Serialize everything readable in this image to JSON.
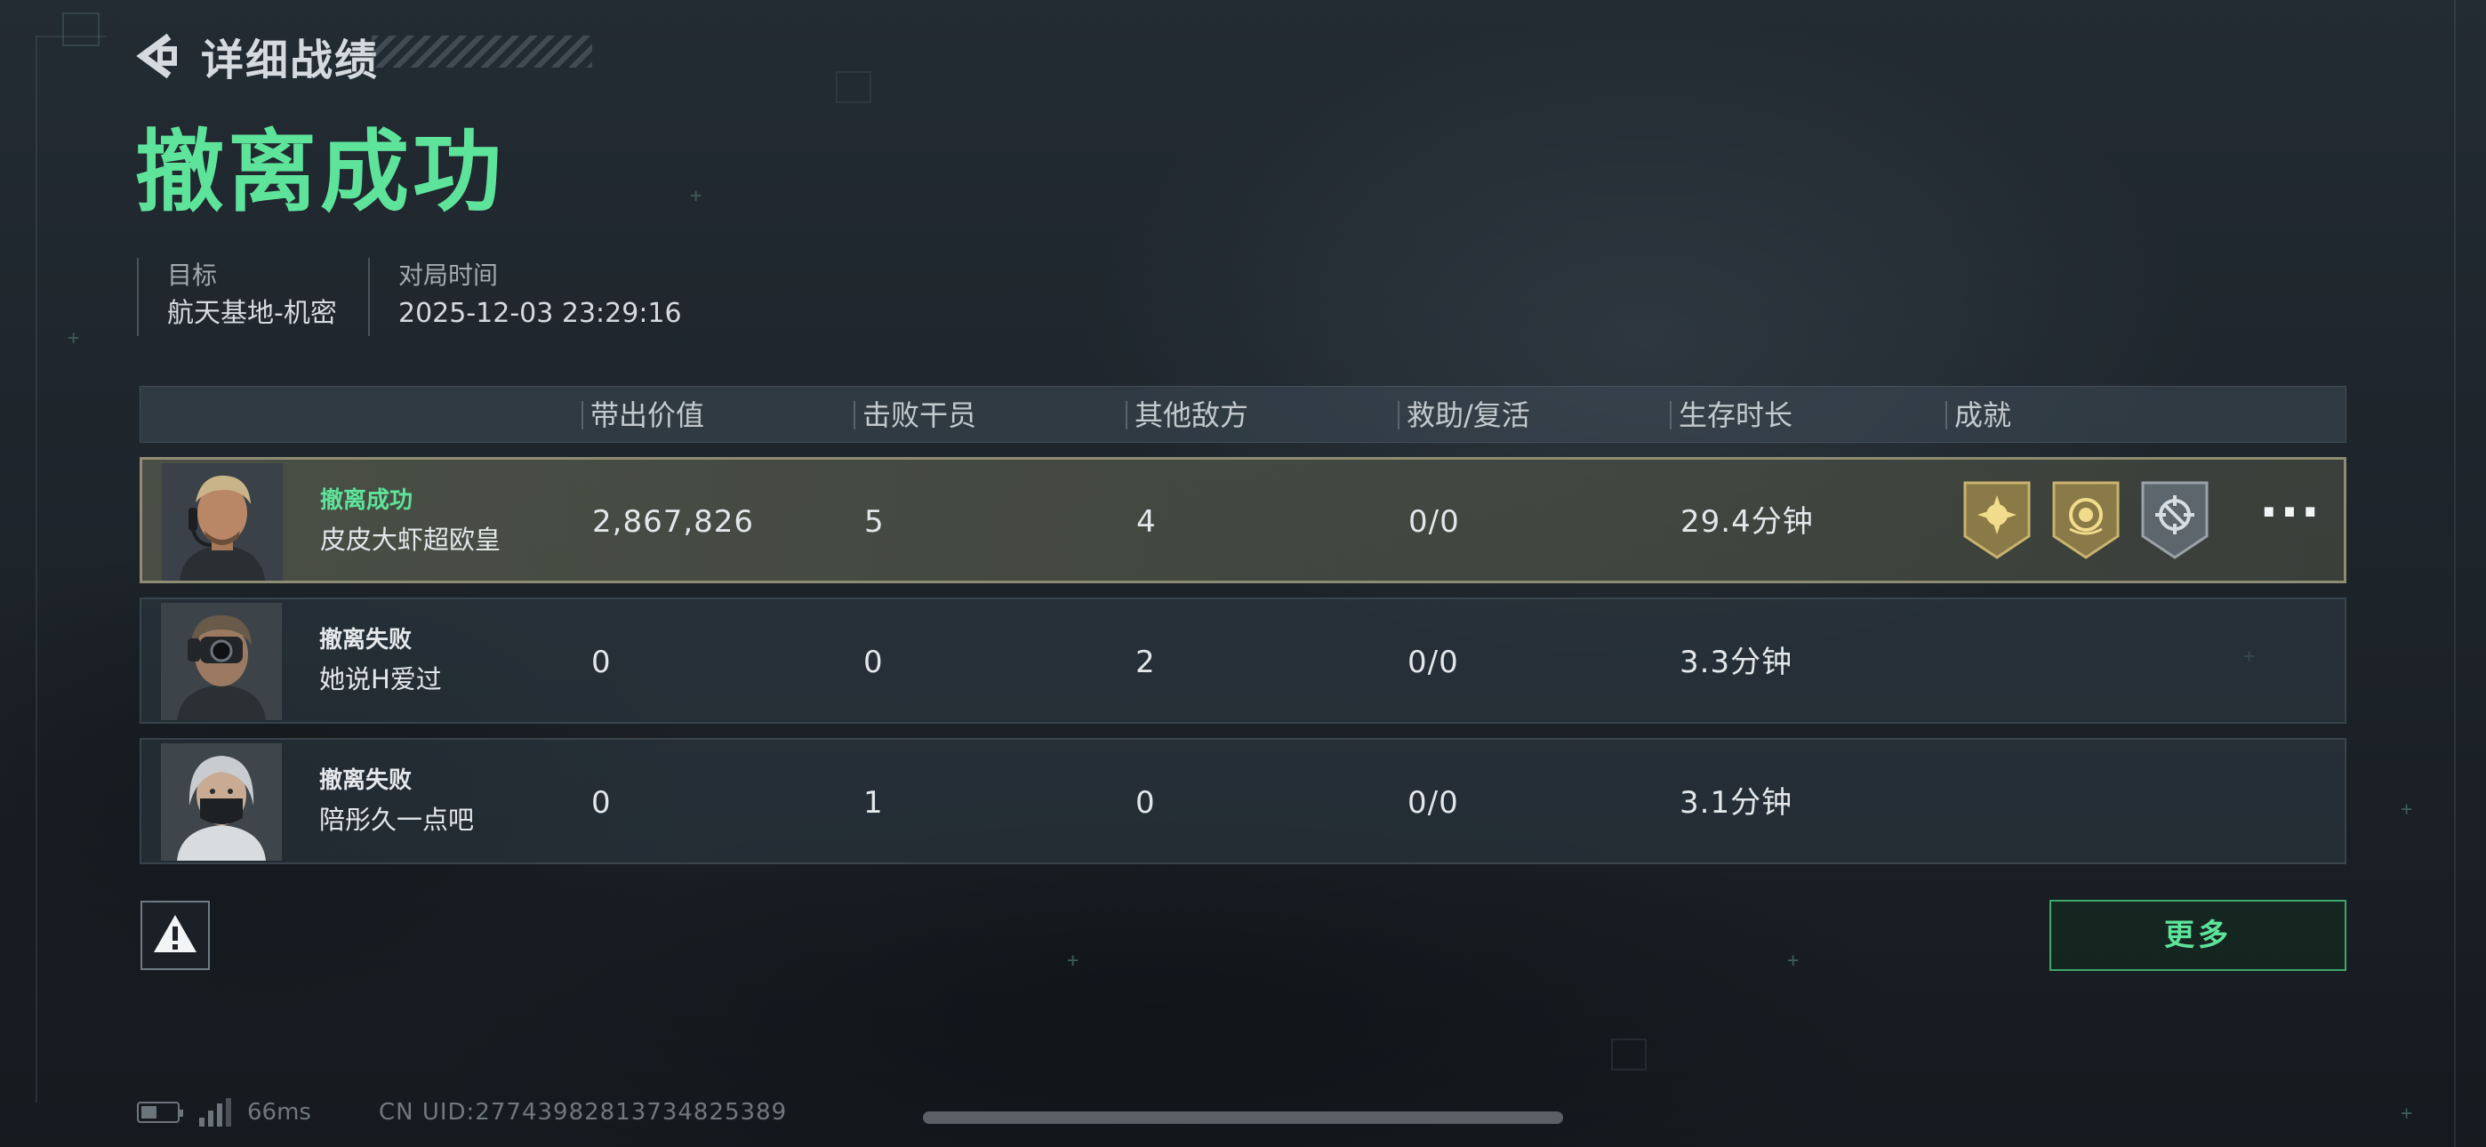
{
  "header": {
    "back_title": "详细战绩",
    "result_title": "撤离成功"
  },
  "meta": {
    "target_label": "目标",
    "target_value": "航天基地-机密",
    "time_label": "对局时间",
    "time_value": "2025-12-03 23:29:16"
  },
  "table": {
    "columns": [
      "带出价值",
      "击败干员",
      "其他敌方",
      "救助/复活",
      "生存时长",
      "成就"
    ],
    "rows": [
      {
        "status": "撤离成功",
        "name": "皮皮大虾超欧皇",
        "value": "2,867,826",
        "kills": "5",
        "other_enemies": "4",
        "assist_revive": "0/0",
        "survival": "29.4分钟",
        "achievements": [
          "sun-emblem-badge",
          "crest-emblem-badge",
          "crosshair-emblem-badge"
        ],
        "more": "···"
      },
      {
        "status": "撤离失败",
        "name": "她说H爱过",
        "value": "0",
        "kills": "0",
        "other_enemies": "2",
        "assist_revive": "0/0",
        "survival": "3.3分钟"
      },
      {
        "status": "撤离失败",
        "name": "陪彤久一点吧",
        "value": "0",
        "kills": "1",
        "other_enemies": "0",
        "assist_revive": "0/0",
        "survival": "3.1分钟"
      }
    ]
  },
  "buttons": {
    "more": "更多",
    "report_icon": "warning-icon"
  },
  "footer": {
    "battery_level": 0.45,
    "ping": "66ms",
    "uid": "CN UID:27743982813734825389"
  },
  "colors": {
    "accent_green": "#5ee39a",
    "highlight_row_border": "#8e8c72",
    "background": "#1f262d"
  }
}
